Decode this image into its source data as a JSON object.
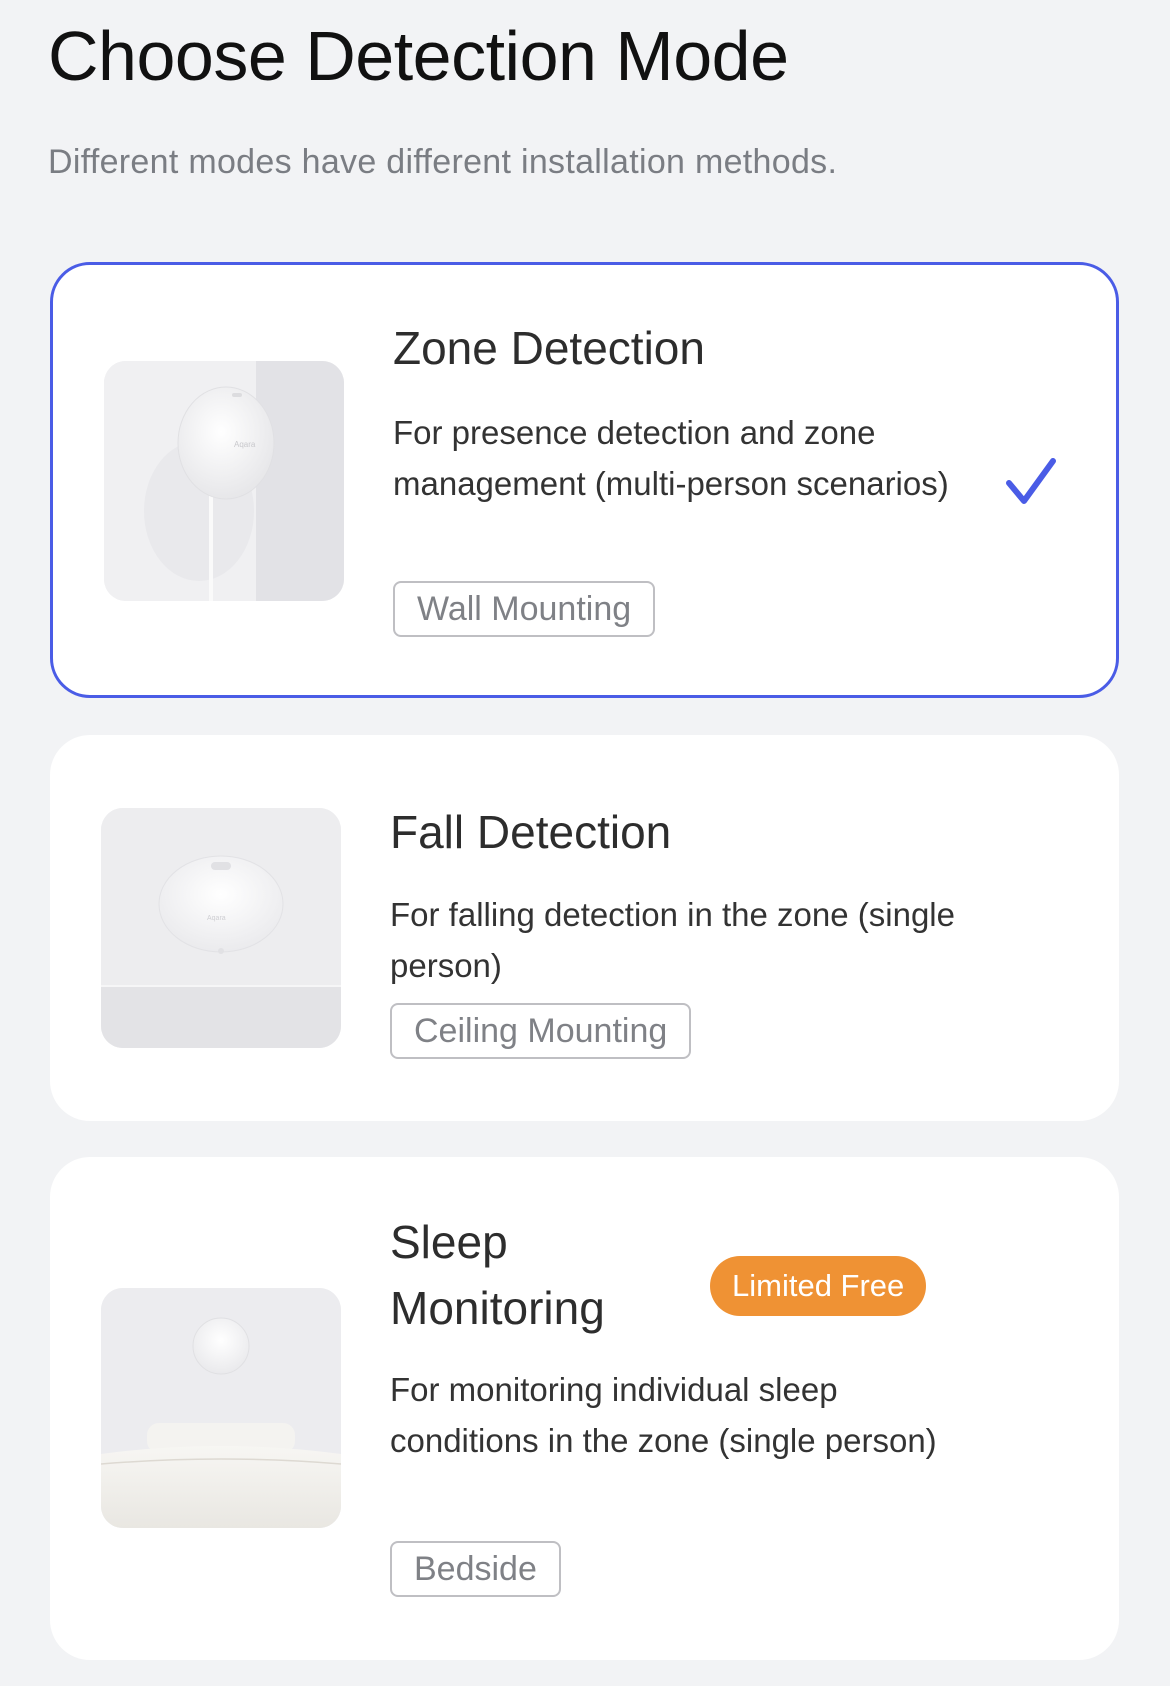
{
  "header": {
    "title": "Choose Detection Mode",
    "subtitle": "Different modes have different installation methods."
  },
  "modes": [
    {
      "name": "Zone Detection",
      "description": "For presence detection and zone management (multi-person scenarios)",
      "tag": "Wall Mounting",
      "selected": true,
      "device_label": "Aqara"
    },
    {
      "name": "Fall Detection",
      "description": "For falling detection in the zone (single person)",
      "tag": "Ceiling Mounting",
      "selected": false,
      "device_label": "Aqara"
    },
    {
      "name_line1": "Sleep",
      "name_line2": "Monitoring",
      "description": "For monitoring individual sleep conditions in the zone (single person)",
      "tag": "Bedside",
      "badge": "Limited Free",
      "selected": false
    }
  ],
  "colors": {
    "accent": "#4a5ce6",
    "badge": "#ef9234",
    "background": "#f2f3f5"
  },
  "icons": {
    "selected": "checkmark-icon"
  }
}
